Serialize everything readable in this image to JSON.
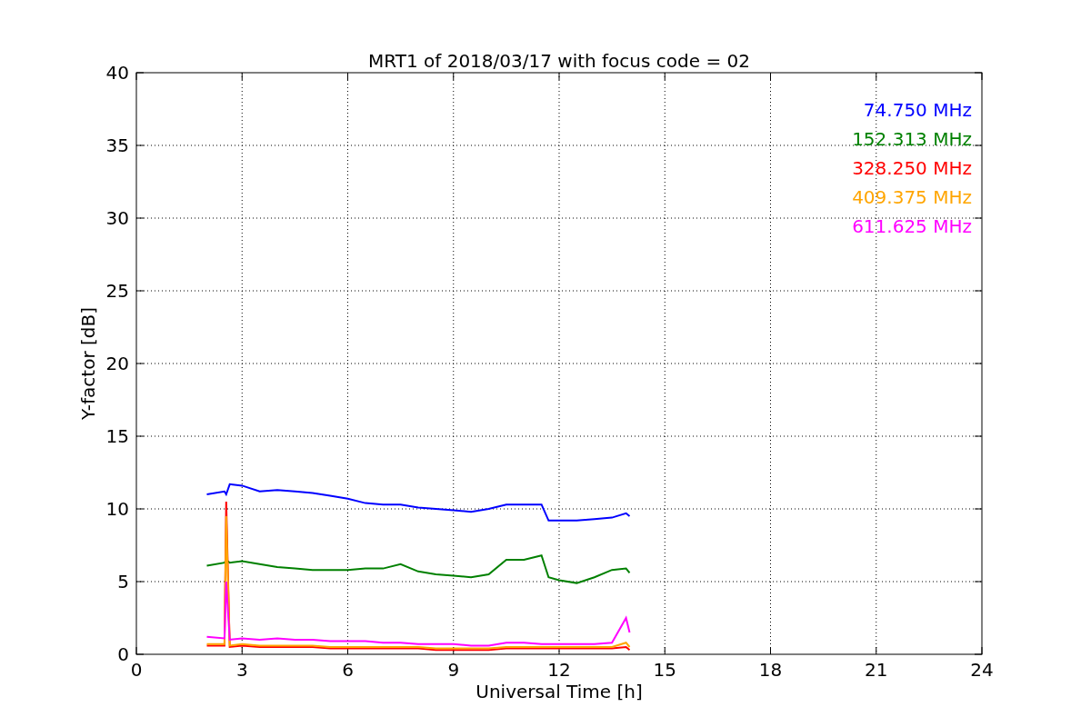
{
  "chart": {
    "chart_data": {
      "type": "line",
      "grid": true,
      "title": "MRT1 of 2018/03/17 with focus code = 02",
      "xlabel": "Universal Time [h]",
      "ylabel": "Y-factor [dB]",
      "xlim": [
        0,
        24
      ],
      "ylim": [
        0,
        40
      ],
      "xticks": [
        0,
        3,
        6,
        9,
        12,
        15,
        18,
        21,
        24
      ],
      "yticks": [
        0,
        5,
        10,
        15,
        20,
        25,
        30,
        35,
        40
      ],
      "x": [
        2,
        2.5,
        2.55,
        2.65,
        3,
        3.5,
        4,
        4.5,
        5,
        5.5,
        6,
        6.5,
        7,
        7.5,
        8,
        8.5,
        9,
        9.5,
        10,
        10.5,
        11,
        11.5,
        11.7,
        12,
        12.5,
        13,
        13.5,
        13.9,
        14
      ],
      "series": [
        {
          "name": "74.750 MHz",
          "color": "#0000ff",
          "values": [
            11.0,
            11.2,
            11.0,
            11.7,
            11.6,
            11.2,
            11.3,
            11.2,
            11.1,
            10.9,
            10.7,
            10.4,
            10.3,
            10.3,
            10.1,
            10.0,
            9.9,
            9.8,
            10.0,
            10.3,
            10.3,
            10.3,
            9.2,
            9.2,
            9.2,
            9.3,
            9.4,
            9.7,
            9.5
          ]
        },
        {
          "name": "152.313 MHz",
          "color": "#008000",
          "values": [
            6.1,
            6.3,
            6.5,
            6.3,
            6.4,
            6.2,
            6.0,
            5.9,
            5.8,
            5.8,
            5.8,
            5.9,
            5.9,
            6.2,
            5.7,
            5.5,
            5.4,
            5.3,
            5.5,
            6.5,
            6.5,
            6.8,
            5.3,
            5.1,
            4.9,
            5.3,
            5.8,
            5.9,
            5.6
          ]
        },
        {
          "name": "328.250 MHz",
          "color": "#ff0000",
          "values": [
            0.6,
            0.6,
            10.5,
            0.5,
            0.6,
            0.5,
            0.5,
            0.5,
            0.5,
            0.4,
            0.4,
            0.4,
            0.4,
            0.4,
            0.4,
            0.3,
            0.3,
            0.3,
            0.3,
            0.4,
            0.4,
            0.4,
            0.4,
            0.4,
            0.4,
            0.4,
            0.4,
            0.5,
            0.3
          ]
        },
        {
          "name": "409.375 MHz",
          "color": "#ffa500",
          "values": [
            0.7,
            0.7,
            9.5,
            0.6,
            0.7,
            0.6,
            0.6,
            0.6,
            0.6,
            0.5,
            0.5,
            0.5,
            0.5,
            0.5,
            0.5,
            0.4,
            0.4,
            0.4,
            0.4,
            0.5,
            0.5,
            0.5,
            0.5,
            0.5,
            0.5,
            0.5,
            0.5,
            0.8,
            0.5
          ]
        },
        {
          "name": "611.625 MHz",
          "color": "#ff00ff",
          "values": [
            1.2,
            1.1,
            5.0,
            1.0,
            1.1,
            1.0,
            1.1,
            1.0,
            1.0,
            0.9,
            0.9,
            0.9,
            0.8,
            0.8,
            0.7,
            0.7,
            0.7,
            0.6,
            0.6,
            0.8,
            0.8,
            0.7,
            0.7,
            0.7,
            0.7,
            0.7,
            0.8,
            2.5,
            1.5
          ]
        }
      ]
    }
  }
}
